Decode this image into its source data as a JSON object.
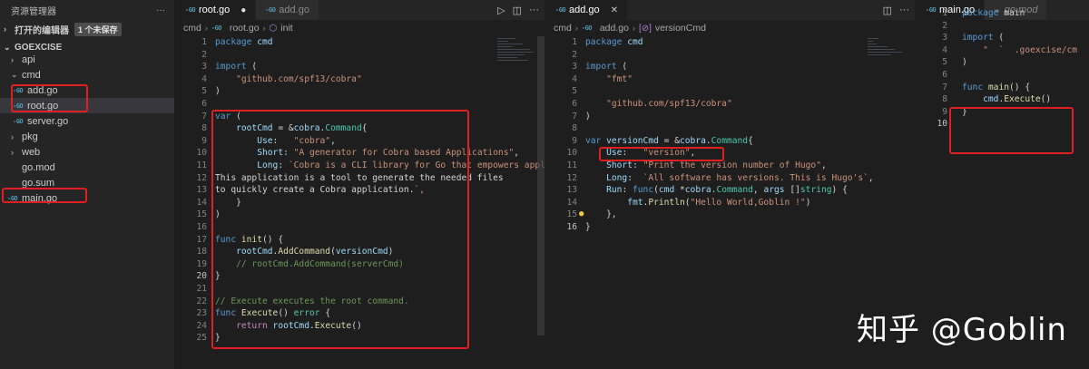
{
  "sidebar": {
    "title": "资源管理器",
    "more_icon": "ellipsis-icon",
    "open_editors": {
      "label": "打开的编辑器",
      "badge": "1 个未保存"
    },
    "project": "GOEXCISE",
    "tree": [
      {
        "label": "api",
        "kind": "folder",
        "state": "collapsed"
      },
      {
        "label": "cmd",
        "kind": "folder",
        "state": "expanded"
      },
      {
        "label": "add.go",
        "kind": "go-file"
      },
      {
        "label": "root.go",
        "kind": "go-file"
      },
      {
        "label": "server.go",
        "kind": "go-file"
      },
      {
        "label": "pkg",
        "kind": "folder",
        "state": "collapsed"
      },
      {
        "label": "web",
        "kind": "folder",
        "state": "collapsed"
      },
      {
        "label": "go.mod",
        "kind": "file"
      },
      {
        "label": "go.sum",
        "kind": "file"
      },
      {
        "label": "main.go",
        "kind": "go-file"
      }
    ]
  },
  "editor1": {
    "tabs": [
      {
        "label": "root.go",
        "dirty": true
      },
      {
        "label": "add.go"
      }
    ],
    "breadcrumb": {
      "folder": "cmd",
      "file": "root.go",
      "symbol": "init"
    },
    "lines": [
      "package cmd",
      "",
      "import (",
      "    \"github.com/spf13/cobra\"",
      ")",
      "",
      "var (",
      "    rootCmd = &cobra.Command{",
      "        Use:   \"cobra\",",
      "        Short: \"A generator for Cobra based Applications\",",
      "        Long: `Cobra is a CLI library for Go that empowers applications.",
      "This application is a tool to generate the needed files",
      "to quickly create a Cobra application.`,",
      "    }",
      ")",
      "",
      "func init() {",
      "    rootCmd.AddCommand(versionCmd)",
      "    // rootCmd.AddCommand(serverCmd)",
      "}",
      "",
      "// Execute executes the root command.",
      "func Execute() error {",
      "    return rootCmd.Execute()",
      "}"
    ]
  },
  "editor2": {
    "tabs": [
      {
        "label": "add.go"
      }
    ],
    "breadcrumb": {
      "folder": "cmd",
      "file": "add.go",
      "symbol": "versionCmd"
    },
    "lines": [
      "package cmd",
      "",
      "import (",
      "    \"fmt\"",
      "",
      "    \"github.com/spf13/cobra\"",
      ")",
      "",
      "var versionCmd = &cobra.Command{",
      "    Use:   \"version\",",
      "    Short: \"Print the version number of Hugo\",",
      "    Long:  `All software has versions. This is Hugo's`,",
      "    Run: func(cmd *cobra.Command, args []string) {",
      "        fmt.Println(\"Hello World,Goblin !\")",
      "    },",
      "}"
    ]
  },
  "editor3": {
    "tabs": [
      {
        "label": "main.go"
      },
      {
        "label": "go.mod",
        "italic": true
      }
    ],
    "lines": [
      "package main",
      "",
      "import (",
      "    \"  `  .goexcise/cm",
      ")",
      "",
      "func main() {",
      "    cmd.Execute()",
      "}",
      ""
    ]
  },
  "watermark": "知乎 @Goblin",
  "colors": {
    "annotation_box": "#e02020",
    "background": "#1e1e1e",
    "go_icon": "#519aba"
  }
}
